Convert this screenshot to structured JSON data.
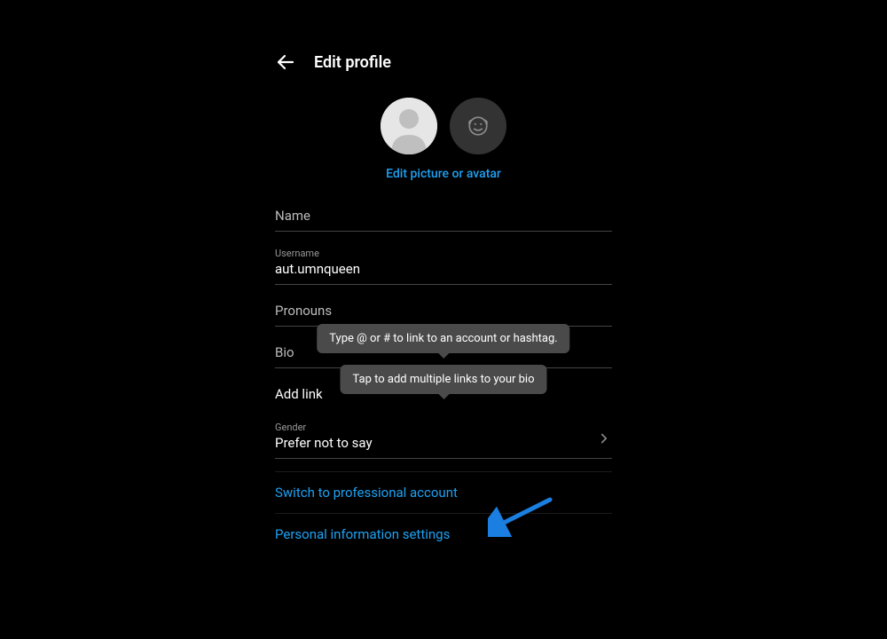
{
  "header": {
    "title": "Edit profile"
  },
  "editPictureLink": "Edit picture or avatar",
  "fields": {
    "name": {
      "label": "Name",
      "value": ""
    },
    "username": {
      "label": "Username",
      "value": "aut.umnqueen"
    },
    "pronouns": {
      "label": "Pronouns",
      "value": ""
    },
    "bio": {
      "label": "Bio",
      "value": ""
    },
    "addLink": {
      "label": "Add link"
    },
    "gender": {
      "label": "Gender",
      "value": "Prefer not to say"
    }
  },
  "tooltips": {
    "atHash": "Type @ or # to link to an account or hashtag.",
    "multiLinks": "Tap to add multiple links to your bio"
  },
  "links": {
    "professional": "Switch to professional account",
    "personalInfo": "Personal information settings"
  }
}
